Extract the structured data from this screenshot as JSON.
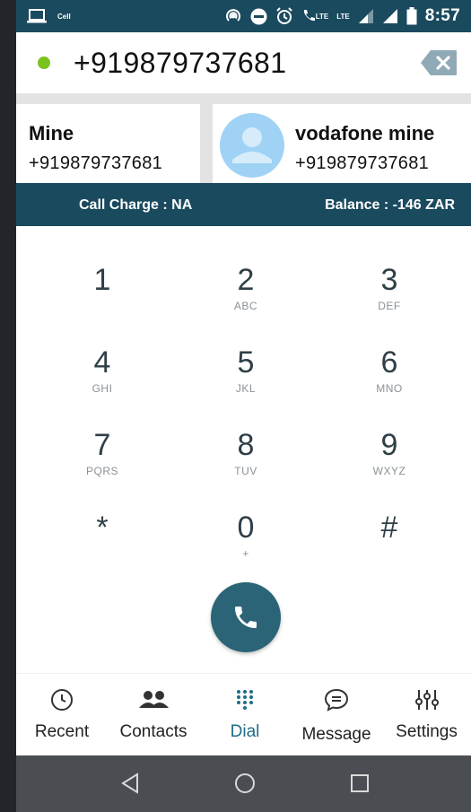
{
  "status_bar": {
    "time": "8:57",
    "carrier_label": "Cell",
    "network_1": "LTE",
    "network_2": "LTE",
    "bg_color": "#1a4a5e"
  },
  "number_display": {
    "value": "+919879737681",
    "status_dot_color": "#7cc21f"
  },
  "contacts": [
    {
      "name": "Mine",
      "number": "+919879737681"
    },
    {
      "name": "vodafone mine",
      "number": "+919879737681",
      "avatar": "person-icon"
    }
  ],
  "charge_bar": {
    "call_charge": "Call Charge : NA",
    "balance": "Balance : -146 ZAR"
  },
  "dialpad": {
    "keys": [
      {
        "digit": "1",
        "letters": ""
      },
      {
        "digit": "2",
        "letters": "ABC"
      },
      {
        "digit": "3",
        "letters": "DEF"
      },
      {
        "digit": "4",
        "letters": "GHI"
      },
      {
        "digit": "5",
        "letters": "JKL"
      },
      {
        "digit": "6",
        "letters": "MNO"
      },
      {
        "digit": "7",
        "letters": "PQRS"
      },
      {
        "digit": "8",
        "letters": "TUV"
      },
      {
        "digit": "9",
        "letters": "WXYZ"
      },
      {
        "digit": "*",
        "letters": ""
      },
      {
        "digit": "0",
        "letters": "+"
      },
      {
        "digit": "#",
        "letters": ""
      }
    ],
    "call_button_color": "#2a6476"
  },
  "bottom_nav": {
    "items": [
      {
        "label": "Recent",
        "icon": "clock-icon"
      },
      {
        "label": "Contacts",
        "icon": "people-icon"
      },
      {
        "label": "Dial",
        "icon": "dialpad-icon",
        "active": true
      },
      {
        "label": "Message",
        "icon": "message-icon"
      },
      {
        "label": "Settings",
        "icon": "sliders-icon"
      }
    ],
    "active_color": "#1f6c86"
  },
  "system_nav": [
    "back-icon",
    "home-icon",
    "recents-icon"
  ]
}
